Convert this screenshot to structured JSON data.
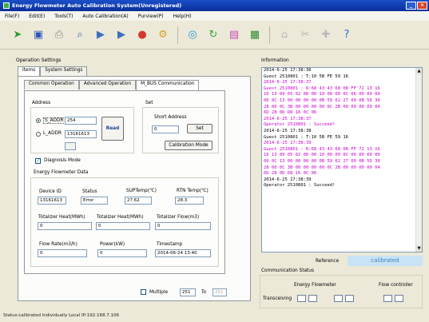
{
  "window": {
    "title": "Energy Flowmeter Auto Calibration System(Unregistered)"
  },
  "menu": [
    "File(F)",
    "Edit(E)",
    "Tools(T)",
    "Auto Calibration(A)",
    "Purview(P)",
    "Help(H)"
  ],
  "toolbar_icons": [
    "run-icon",
    "save-icon",
    "print-icon",
    "search-icon",
    "play-icon",
    "play-icon",
    "record-icon",
    "settings-icon",
    "refresh-icon",
    "refresh-icon",
    "chart-icon",
    "spreadsheet-icon",
    "home-icon",
    "tools-icon",
    "plugin-icon",
    "help-icon"
  ],
  "operation": {
    "title": "Operation Settings",
    "tabs": [
      "Items",
      "System Settings"
    ],
    "subtabs": [
      "Common Operation",
      "Advanced Operation",
      "M_BUS Communication"
    ],
    "address": {
      "label": "Address",
      "s_addr_label": "S_ADDR",
      "s_addr_value": "254",
      "l_addr_label": "L_ADDR",
      "l_addr_value": "13161613",
      "read_button": "Read"
    },
    "set": {
      "label": "Set",
      "short_address_label": "Short Address",
      "short_address_value": "0",
      "set_button": "Set",
      "calibration_button": "Calibration Mode"
    },
    "diagnosis_label": "Diagnosis Mode",
    "data": {
      "label": "Energy Flowmeter Data",
      "device_id_label": "Device ID",
      "device_id_value": "13161613",
      "status_label": "Status",
      "status_value": "Error",
      "sup_temp_label": "SUPTemp(℃)",
      "sup_temp_value": "27.62",
      "rtn_temp_label": "RTN Temp(℃)",
      "rtn_temp_value": "28.3",
      "tot_heat_mwh_label": "Totalizer Heat(MWh)",
      "tot_heat_mwh_value": "0",
      "tot_heat_mj_label": "Totalizer Heat(MWh)",
      "tot_heat_mj_value": "0",
      "tot_flow_label": "Totalizer Flow(m3)",
      "tot_flow_value": "0",
      "flow_rate_label": "Flow Rate(m3/h)",
      "flow_rate_value": "0",
      "power_label": "Power(kW)",
      "power_value": "0",
      "timestamp_label": "Timestamp",
      "timestamp_value": "2014-06-24 13:40"
    },
    "multiple_label": "Multiple",
    "multiple_value": "251",
    "to_label": "To",
    "to_value": "251"
  },
  "information": {
    "title": "Information",
    "lines": [
      {
        "text": "2014-6-25 17:38:36",
        "color": "#000000"
      },
      {
        "text": "Guest 2510801 : T:10 5B FE 59 16",
        "color": "#000000"
      },
      {
        "text": "2014-6-25 17:38:37",
        "color": "#cc00cc"
      },
      {
        "text": "Guest 2510801 : R:68 43 43 68 08 FF 72 13 16",
        "color": "#cc00cc"
      },
      {
        "text": "16 13 89 05 02 0D 00 10 00 00 0C 06 00 00 00",
        "color": "#cc00cc"
      },
      {
        "text": "00 0C 13 00 00 00 00 0B 59 62 27 00 0B 5D 30",
        "color": "#cc00cc"
      },
      {
        "text": "28 00 0C 3B 00 00 00 00 0C 2B 00 00 00 00 04",
        "color": "#cc00cc"
      },
      {
        "text": "6D 28 0D D8 16 0C 06",
        "color": "#cc00cc"
      },
      {
        "text": "2014-6-25 17:38:37",
        "color": "#cc00cc"
      },
      {
        "text": "Operator 2510801 : Succeed!",
        "color": "#cc00cc"
      },
      {
        "text": "2014-6-25 17:38:38",
        "color": "#000000"
      },
      {
        "text": "Guest 2510801 : T:10 5B FE 59 16",
        "color": "#000000"
      },
      {
        "text": "2014-6-25 17:38:39",
        "color": "#cc00cc"
      },
      {
        "text": "Guest 2510801 : R:68 43 43 68 08 FF 72 13 16",
        "color": "#cc00cc"
      },
      {
        "text": "16 13 89 05 02 0D 00 10 00 00 0C 06 00 00 00",
        "color": "#cc00cc"
      },
      {
        "text": "00 0C 13 00 00 00 00 0B 59 62 27 00 0B 5D 30",
        "color": "#cc00cc"
      },
      {
        "text": "28 00 0C 3B 00 00 00 00 0C 2B 00 00 00 00 04",
        "color": "#cc00cc"
      },
      {
        "text": "6D 28 0D D8 16 0C 06",
        "color": "#cc00cc"
      },
      {
        "text": "2014-6-25 17:38:39",
        "color": "#000000"
      },
      {
        "text": "Operator 2510801 : Succeed!",
        "color": "#000000"
      }
    ]
  },
  "reference": {
    "label": "Reference",
    "value": "calibrated",
    "bg": "#c8e4f4",
    "color": "#3a7fc0"
  },
  "comm": {
    "title": "Communication Status",
    "col1": "Energy Flowmeter",
    "col2": "Flow controller",
    "row_label": "Transceiving"
  },
  "status": {
    "text": "Status:calibrated individually   Local IP:192.168.7.106"
  }
}
